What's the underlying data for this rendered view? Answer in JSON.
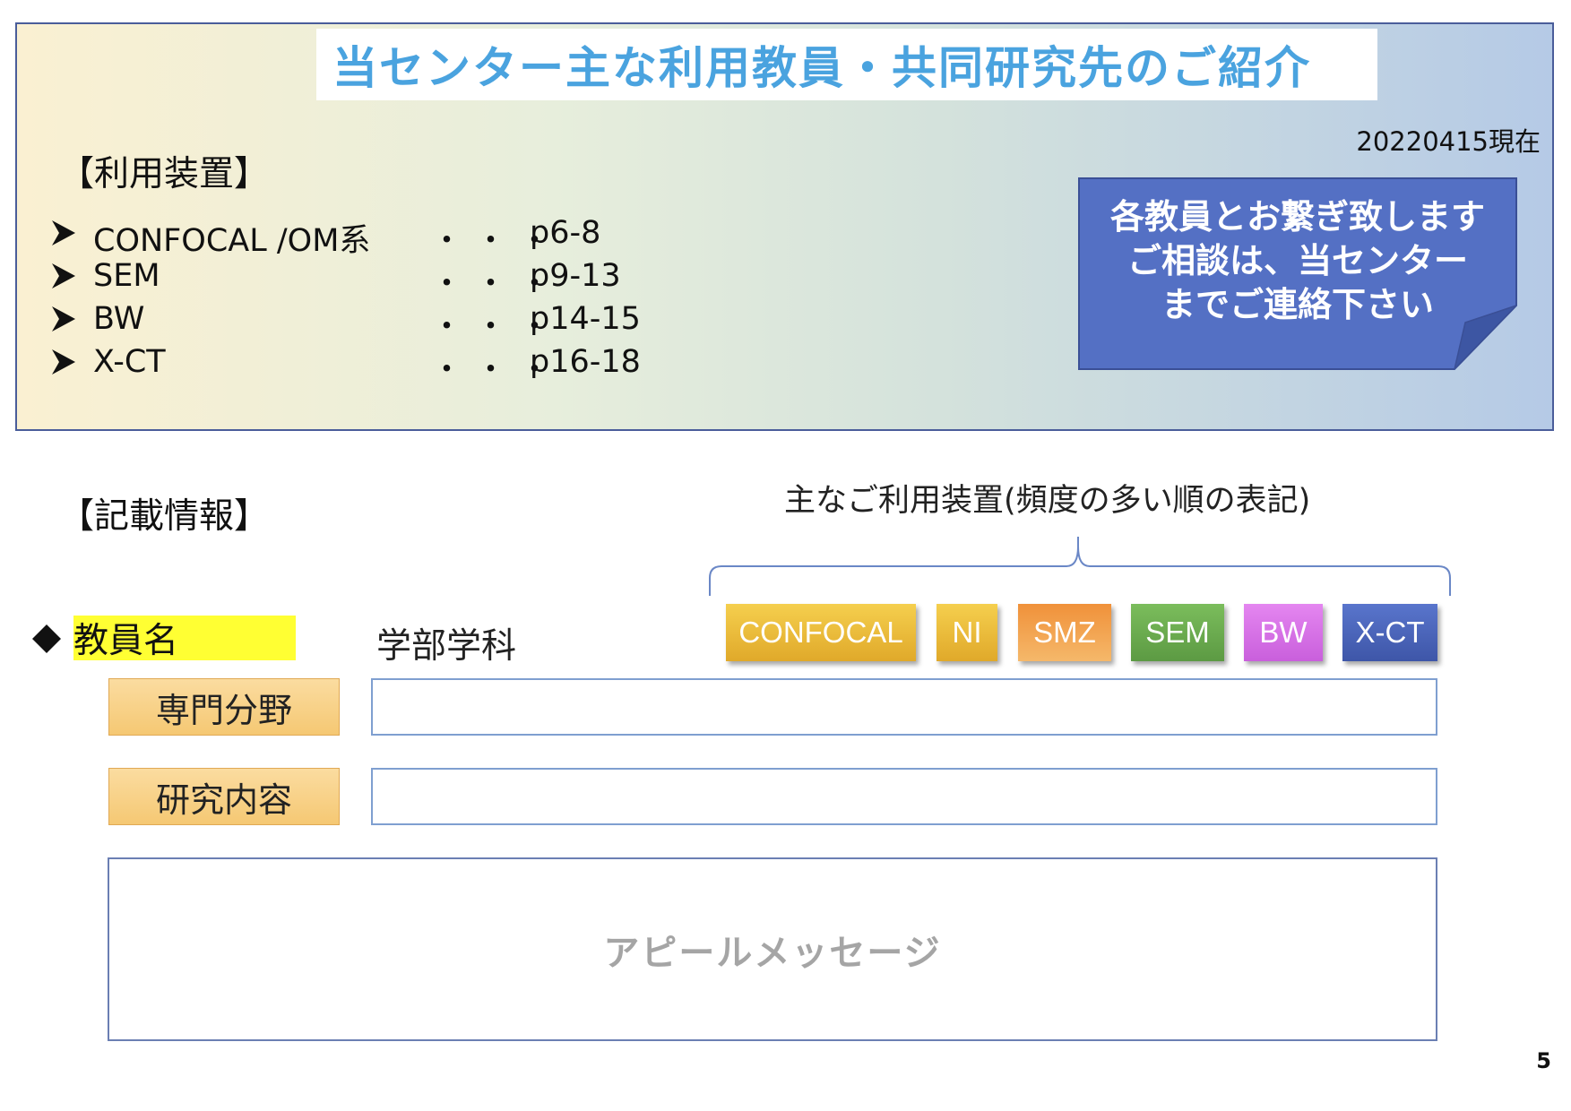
{
  "header": {
    "title": "当センター主な利用教員・共同研究先のご紹介",
    "date": "20220415現在"
  },
  "devices_section": {
    "heading": "【利用装置】",
    "items": [
      {
        "name": "CONFOCAL /OM系",
        "dots": "・・・",
        "pages": "p6-8"
      },
      {
        "name": "SEM",
        "dots": "・・・",
        "pages": "p9-13"
      },
      {
        "name": "BW",
        "dots": "・・・",
        "pages": "p14-15"
      },
      {
        "name": "X-CT",
        "dots": "・・・",
        "pages": "p16-18"
      }
    ]
  },
  "callout": {
    "line1": "各教員とお繋ぎ致します",
    "line2": "ご相談は、当センター",
    "line3": "までご連絡下さい"
  },
  "info_section": {
    "heading": "【記載情報】",
    "brace_caption": "主なご利用装置(頻度の多い順の表記)",
    "faculty_label": "教員名",
    "department_label": "学部学科",
    "specialty_label": "専門分野",
    "research_label": "研究内容",
    "appeal_placeholder": "アピールメッセージ"
  },
  "badges": [
    {
      "label": "CONFOCAL",
      "color": "#e8b92e"
    },
    {
      "label": "NI",
      "color": "#e8b92e"
    },
    {
      "label": "SMZ",
      "color": "#e57f2a"
    },
    {
      "label": "SEM",
      "color": "#6aa84f"
    },
    {
      "label": "BW",
      "color": "#d773e6"
    },
    {
      "label": "X-CT",
      "color": "#4a63b8"
    }
  ],
  "page_number": "5"
}
